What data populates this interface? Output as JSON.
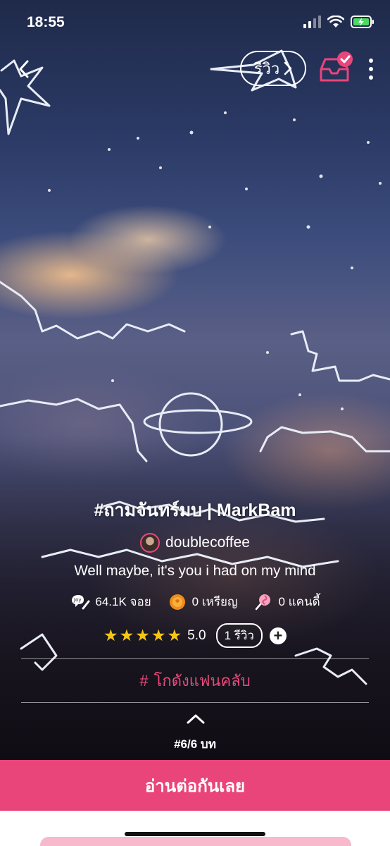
{
  "status_bar": {
    "time": "18:55"
  },
  "topbar": {
    "review_label": "รีวิว"
  },
  "story": {
    "title": "#ถามจันทร์มบ | MarkBam",
    "author": "doublecoffee",
    "tagline": "Well maybe, it's you i had on my mind"
  },
  "stats": {
    "views": "64.1K จอย",
    "coins": "0 เหรียญ",
    "candies": "0 แคนดี้"
  },
  "rating": {
    "stars": "★★★★★",
    "score": "5.0",
    "review_count": "1 รีวิว",
    "add_symbol": "+"
  },
  "fanclub": {
    "label": "โกดังแฟนคลับ",
    "hash_symbol": "#"
  },
  "chapters": {
    "count_label": "#6/6 บท"
  },
  "actions": {
    "read_label": "อ่านต่อกันเลย"
  },
  "colors": {
    "accent": "#e9457a",
    "star": "#f5c518"
  }
}
